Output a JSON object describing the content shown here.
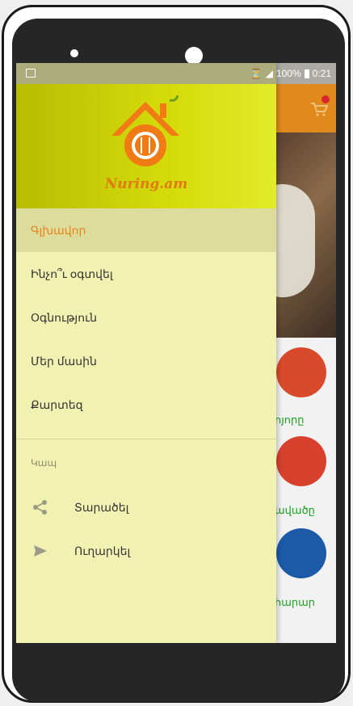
{
  "status_bar": {
    "battery": "100%",
    "time": "0:21"
  },
  "app": {
    "logo_text": "Nuring.am"
  },
  "drawer": {
    "menu_items": [
      {
        "label": "Գլխավոր"
      },
      {
        "label": "Ինչո՞ւ օգտվել"
      },
      {
        "label": "Օգնություն"
      },
      {
        "label": "Մեր մասին"
      },
      {
        "label": "Քարտեզ"
      }
    ],
    "section_title": "Կապ",
    "share_label": "Տարածել",
    "send_label": "Ուղարկել"
  },
  "background": {
    "labels": [
      "ոյորը",
      "ավածը",
      "հարար"
    ]
  },
  "colors": {
    "accent": "#e7831c",
    "drawer_bg": "#f1f2b2",
    "header": "#c6cc06"
  }
}
